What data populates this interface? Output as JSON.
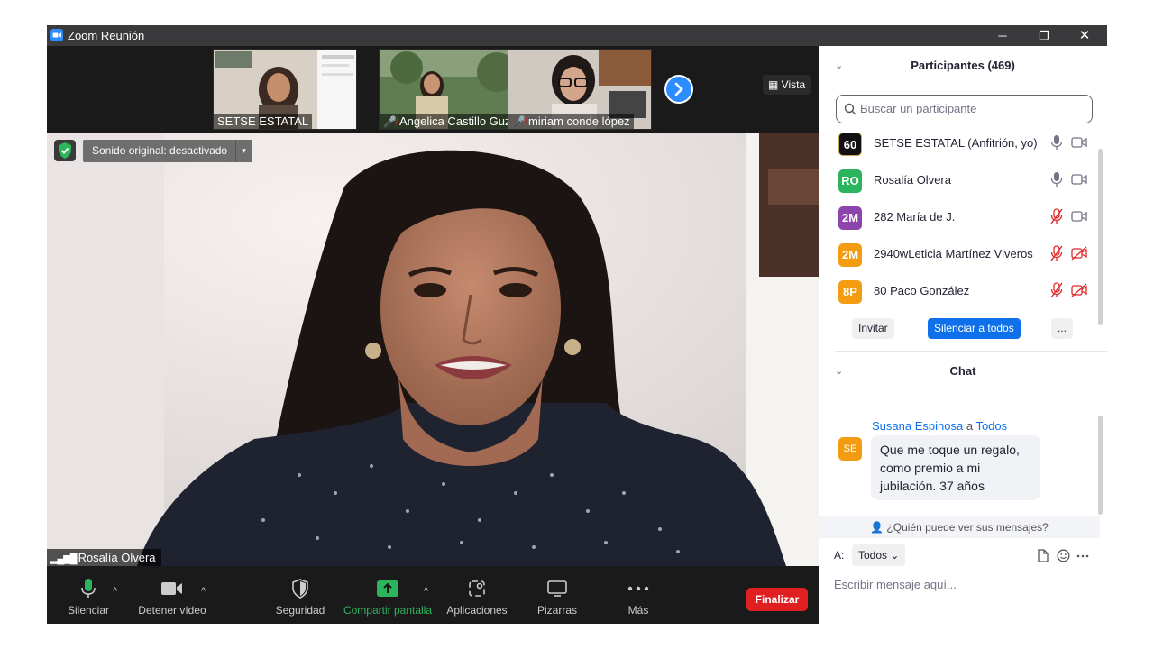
{
  "window": {
    "title": "Zoom Reunión",
    "minimize": "─",
    "restore": "❐",
    "close": "✕"
  },
  "thumbnails": [
    {
      "name": "SETSE ESTATAL",
      "muted": false
    },
    {
      "name": "Angelica Castillo Guz...",
      "muted": true
    },
    {
      "name": "miriam conde lópez",
      "muted": true
    }
  ],
  "view_button": "Vista",
  "video": {
    "original_sound": "Sonido original: desactivado",
    "speaker_name": "Rosalía Olvera"
  },
  "toolbar": {
    "mute": "Silenciar",
    "stop_video": "Detener vídeo",
    "security": "Seguridad",
    "share": "Compartir pantalla",
    "apps": "Aplicaciones",
    "whiteboards": "Pizarras",
    "more": "Más",
    "end": "Finalizar"
  },
  "participants": {
    "title": "Participantes (469)",
    "search_placeholder": "Buscar un participante",
    "list": [
      {
        "avatar": "60",
        "name": "SETSE ESTATAL (Anfitrión, yo)",
        "color": "#1a1a1a",
        "muted": false,
        "video_off": false
      },
      {
        "avatar": "RO",
        "name": "Rosalía Olvera",
        "color": "#2db55d",
        "muted": false,
        "video_off": false
      },
      {
        "avatar": "2M",
        "name": "282 María de J.",
        "color": "#8e44ad",
        "muted": true,
        "video_off": false
      },
      {
        "avatar": "2M",
        "name": "2940wLeticia Martínez Viveros",
        "color": "#f39c12",
        "muted": true,
        "video_off": true
      },
      {
        "avatar": "8P",
        "name": "80  Paco González",
        "color": "#f39c12",
        "muted": true,
        "video_off": true
      }
    ],
    "invite": "Invitar",
    "mute_all": "Silenciar a todos",
    "more": "..."
  },
  "chat": {
    "title": "Chat",
    "messages": [
      {
        "avatar": "SE",
        "sender": "Susana Espinosa",
        "to_word": "a",
        "recipient": "Todos",
        "text": "Que me toque un regalo, como premio a mi jubilación. 37 años"
      }
    ],
    "who_can_see": "¿Quién puede ver sus mensajes?",
    "to_label": "A:",
    "to_value": "Todos",
    "input_placeholder": "Escribir mensaje aquí..."
  }
}
